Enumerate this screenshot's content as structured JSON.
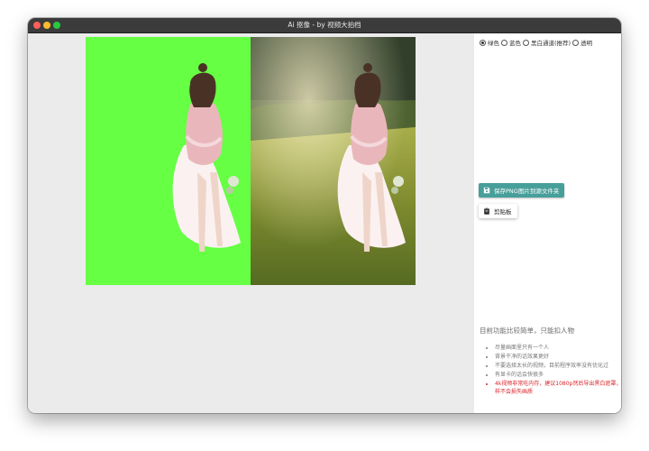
{
  "window": {
    "title": "Ai 抠像 - by 视频大拍档"
  },
  "options": {
    "selected": 0,
    "items": [
      "绿色",
      "蓝色",
      "黑白通道(推荐)",
      "透明"
    ]
  },
  "actions": {
    "save_label": "保存PNG图片到源文件夹",
    "clipboard_label": "剪贴板"
  },
  "info": {
    "title": "目前功能比较简单，只能扣人物",
    "tips": [
      "尽量画面里只有一个人",
      "背景干净的话效果更好",
      "不要选择太长的视频，目前程序效率没有优化过",
      "有显卡的话会快很多",
      "4k视频非常吃内存，建议1080p然后导出黑白遮罩，这样不会损失画质"
    ]
  },
  "colors": {
    "chroma_green": "#66ff44",
    "save_button": "#479f9a",
    "warning_text": "#d9262c"
  }
}
